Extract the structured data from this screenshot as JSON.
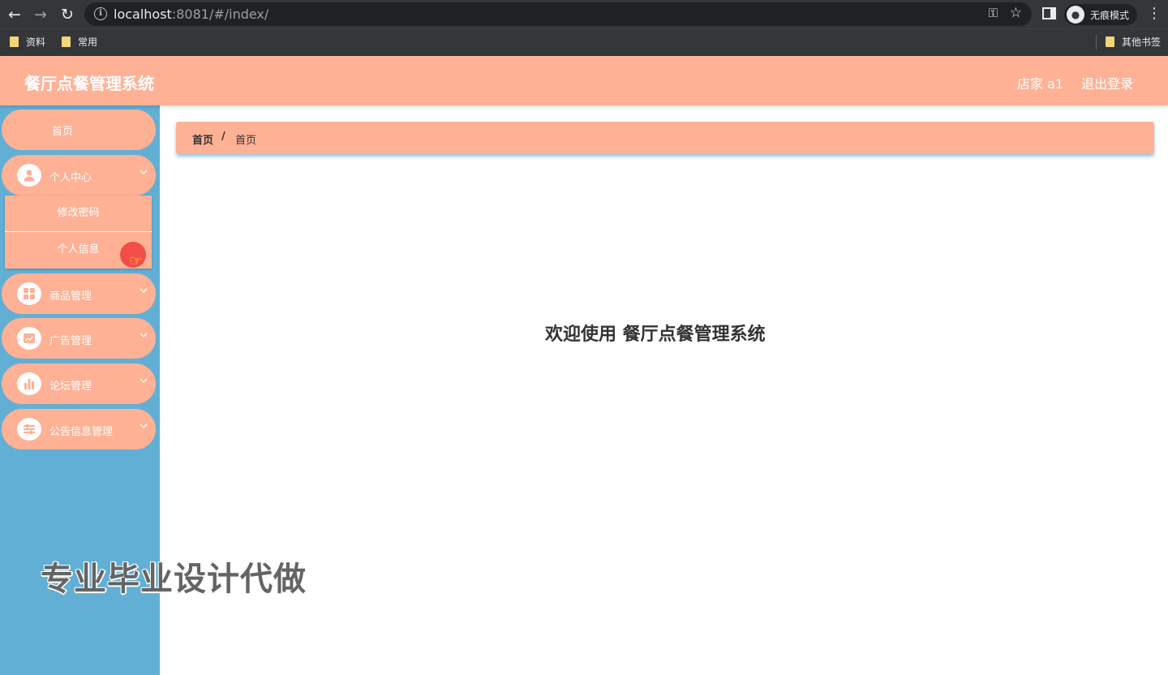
{
  "browser": {
    "url_host": "localhost",
    "url_rest": ":8081/#/index/",
    "incognito_label": "无痕模式",
    "bookmarks": [
      "资料",
      "常用"
    ],
    "other_bookmarks": "其他书签",
    "icons": {
      "back": "back-arrow-icon",
      "forward": "forward-arrow-icon",
      "reload": "reload-icon",
      "site_info": "info-icon",
      "password": "key-icon",
      "bookmark": "star-icon",
      "side_panel": "side-panel-icon",
      "incognito": "incognito-icon",
      "menu": "kebab-menu-icon"
    }
  },
  "header": {
    "title": "餐厅点餐管理系统",
    "user": "店家 a1",
    "logout": "退出登录"
  },
  "sidebar": {
    "home": "首页",
    "items": [
      {
        "label": "个人中心",
        "icon": "user-icon",
        "expanded": true
      },
      {
        "label": "商品管理",
        "icon": "grid-icon",
        "expanded": false
      },
      {
        "label": "广告管理",
        "icon": "trend-chart-icon",
        "expanded": false
      },
      {
        "label": "论坛管理",
        "icon": "bar-chart-icon",
        "expanded": false
      },
      {
        "label": "公告信息管理",
        "icon": "sliders-icon",
        "expanded": false
      }
    ],
    "submenu": [
      "修改密码",
      "个人信息"
    ]
  },
  "breadcrumb": {
    "home": "首页",
    "separator": "/",
    "current": "首页"
  },
  "main": {
    "welcome": "欢迎使用 餐厅点餐管理系统"
  },
  "watermark": "专业毕业设计代做",
  "colors": {
    "primary": "#ffb195",
    "sidebar_bg": "#62afd5",
    "chrome_bg": "#35363a"
  }
}
